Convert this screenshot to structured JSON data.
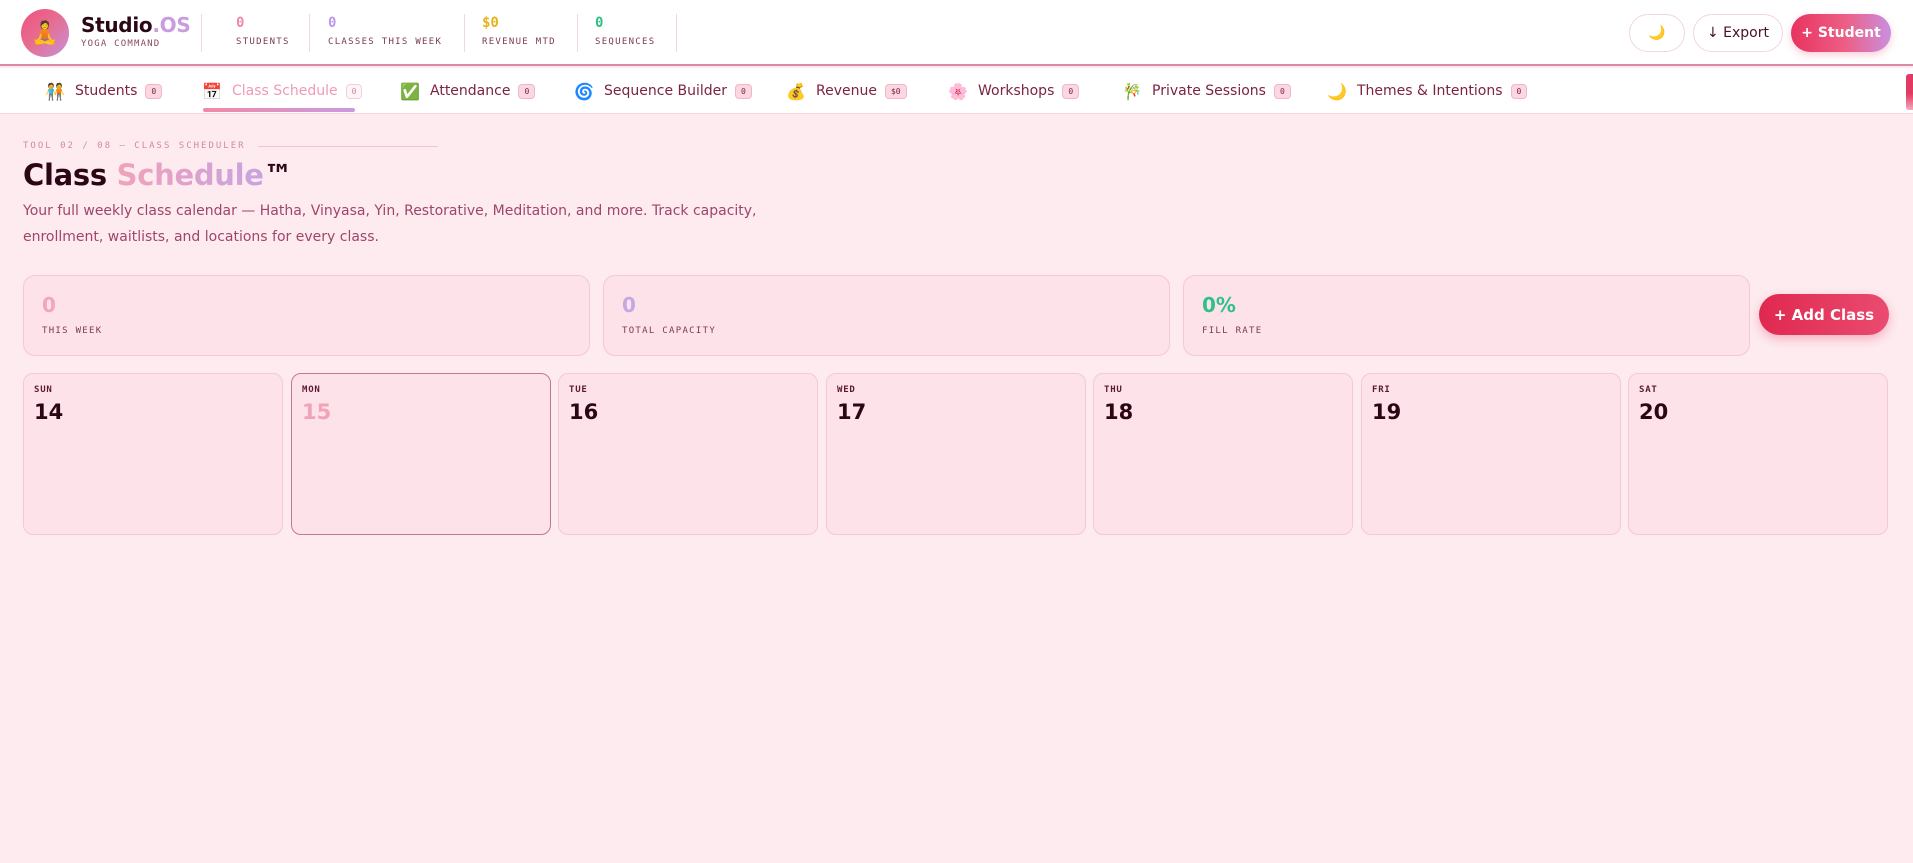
{
  "brand": {
    "name": "Studio",
    "name_suffix": ".OS",
    "subtitle": "YOGA COMMAND",
    "logo_icon": "🧘"
  },
  "header_stats": [
    {
      "value": "0",
      "label": "STUDENTS",
      "color": "#f08aa4"
    },
    {
      "value": "0",
      "label": "CLASSES THIS WEEK",
      "color": "#b99ae6"
    },
    {
      "value": "$0",
      "label": "REVENUE MTD",
      "color": "#e6b21c"
    },
    {
      "value": "0",
      "label": "SEQUENCES",
      "color": "#2fbf85"
    }
  ],
  "header_actions": {
    "theme_icon": "🌙",
    "export_label": "↓ Export",
    "add_student_label": "+ Student"
  },
  "tabs": [
    {
      "label": "Students",
      "badge": "0",
      "icon": "🧑‍🤝‍🧑"
    },
    {
      "label": "Class Schedule",
      "badge": "0",
      "icon": "📅",
      "active": true
    },
    {
      "label": "Attendance",
      "badge": "0",
      "icon": "✅"
    },
    {
      "label": "Sequence Builder",
      "badge": "0",
      "icon": "🌀"
    },
    {
      "label": "Revenue",
      "badge": "$0",
      "icon": "💰"
    },
    {
      "label": "Workshops",
      "badge": "0",
      "icon": "🌸"
    },
    {
      "label": "Private Sessions",
      "badge": "0",
      "icon": "🎋"
    },
    {
      "label": "Themes & Intentions",
      "badge": "0",
      "icon": "🌙"
    }
  ],
  "main": {
    "eyebrow": "TOOL 02 / 08 — CLASS SCHEDULER",
    "title_start": "Class ",
    "title_accent": "Schedule",
    "title_end": "™",
    "description": "Your full weekly class calendar — Hatha, Vinyasa, Yin, Restorative, Meditation, and more. Track capacity, enrollment, waitlists, and locations for every class.",
    "stat_cards": [
      {
        "value": "0",
        "label": "THIS WEEK",
        "color": "#f2a6b9"
      },
      {
        "value": "0",
        "label": "TOTAL CAPACITY",
        "color": "#c6a7e6"
      },
      {
        "value": "0%",
        "label": "FILL RATE",
        "color": "#2fc189"
      }
    ],
    "add_class_label": "+ Add Class",
    "days": [
      {
        "name": "SUN",
        "num": "14"
      },
      {
        "name": "MON",
        "num": "15",
        "today": true
      },
      {
        "name": "TUE",
        "num": "16"
      },
      {
        "name": "WED",
        "num": "17"
      },
      {
        "name": "THU",
        "num": "18"
      },
      {
        "name": "FRI",
        "num": "19"
      },
      {
        "name": "SAT",
        "num": "20"
      }
    ]
  }
}
